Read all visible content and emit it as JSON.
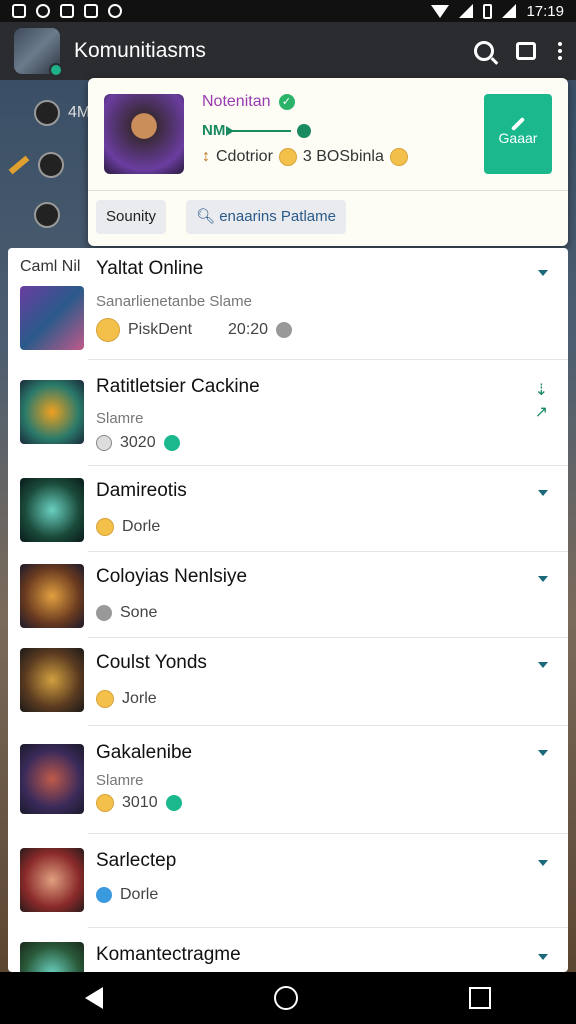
{
  "status_bar": {
    "time": "17:19"
  },
  "app_bar": {
    "title": "Komunitiasms",
    "icons": [
      "search-icon",
      "chat-icon",
      "more-icon"
    ]
  },
  "background": {
    "rows": [
      {
        "label": "4M"
      }
    ]
  },
  "featured": {
    "title": "Notenitan",
    "line_label": "NM",
    "meta_left": "Cdotrior",
    "meta_right": "3 BOSbinla",
    "button_label": "Gaaar",
    "chip_left": "Sounity",
    "chip_search": "enaarins Patlame"
  },
  "list": {
    "header_label": "Caml Nil",
    "items": [
      {
        "name": "Yaltat Online",
        "sub": "Sanarlienetanbe Slame",
        "meta_left": "PiskDent",
        "meta_right": "20:20",
        "action": "chevron"
      },
      {
        "name": "Ratitletsier Cackine",
        "sub": "Slamre",
        "meta_left": "3020",
        "meta_right": "",
        "action": "up"
      },
      {
        "name": "Damireotis",
        "sub": "",
        "meta_left": "Dorle",
        "meta_right": "",
        "action": "chevron"
      },
      {
        "name": "Coloyias Nenlsiye",
        "sub": "",
        "meta_left": "Sone",
        "meta_right": "",
        "action": "chevron"
      },
      {
        "name": "Coulst Yonds",
        "sub": "",
        "meta_left": "Jorle",
        "meta_right": "",
        "action": "chevron"
      },
      {
        "name": "Gakalenibe",
        "sub": "Slamre",
        "meta_left": "3010",
        "meta_right": "",
        "action": "chevron"
      },
      {
        "name": "Sarlectep",
        "sub": "",
        "meta_left": "Dorle",
        "meta_right": "",
        "action": "chevron"
      },
      {
        "name": "Komantectragme",
        "sub": "",
        "meta_left": "",
        "meta_right": "",
        "action": "chevron"
      }
    ]
  },
  "colors": {
    "accent": "#1bb88e",
    "featured_title": "#9a3bb0",
    "chevron": "#1a6a7a"
  }
}
